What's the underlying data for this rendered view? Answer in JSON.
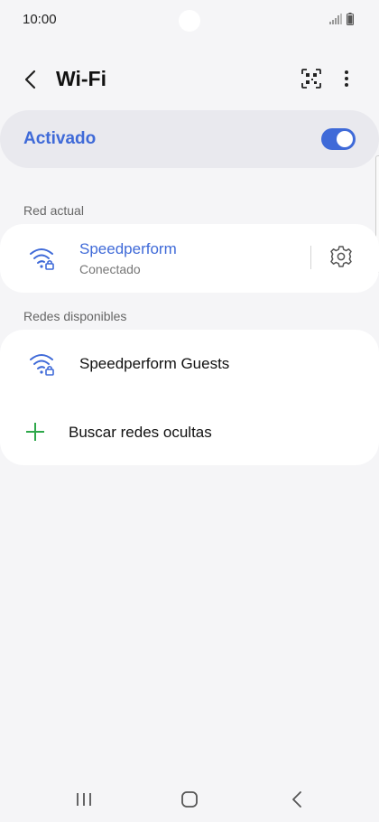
{
  "status_bar": {
    "time": "10:00"
  },
  "header": {
    "title": "Wi-Fi"
  },
  "master_switch": {
    "label": "Activado",
    "state": "on",
    "accent_color": "#3f6ad8"
  },
  "current_network": {
    "section_label": "Red actual",
    "name": "Speedperform",
    "status": "Conectado"
  },
  "available_networks": {
    "section_label": "Redes disponibles",
    "items": [
      {
        "name": "Speedperform Guests"
      }
    ],
    "hidden_networks_label": "Buscar redes ocultas"
  },
  "icons": {
    "back": "back-arrow-icon",
    "qr": "qr-code-icon",
    "more": "more-options-icon",
    "wifi_locked": "wifi-locked-icon",
    "settings": "gear-icon",
    "plus": "plus-icon"
  }
}
